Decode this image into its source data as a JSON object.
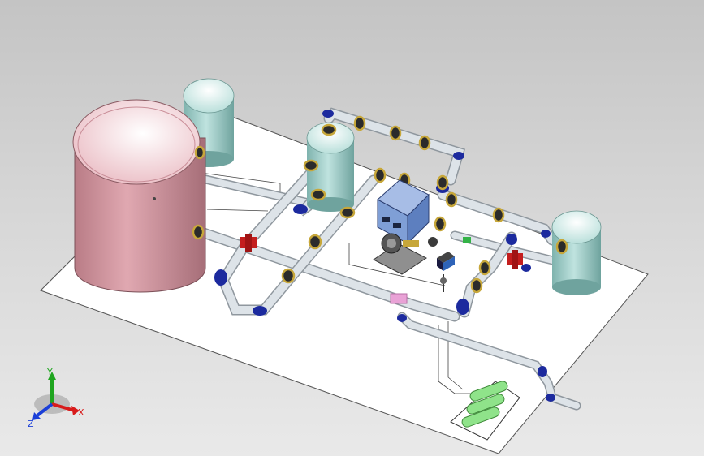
{
  "scene": {
    "colors": {
      "background_top": "#c4c4c4",
      "background_bottom": "#e9e9e9",
      "platform": "#ffffff",
      "platform_edge": "#555555",
      "large_tank": "#d99aa4",
      "large_tank_top": "#f6dde1",
      "small_tank": "#a9d4cf",
      "small_tank_top": "#e3f3f1",
      "pipe": "#d9dfe4",
      "pipe_shadow": "#8f979e",
      "elbow": "#1c2a9e",
      "flange": "#c7a73a",
      "valve_red": "#c41e1e",
      "valve_pink": "#e9a2d6",
      "valve_green": "#34b347",
      "cabinet": "#7f9fd6",
      "cylinder": "#8fe38a"
    },
    "objects": [
      "large-storage-tank",
      "small-tank-top-left",
      "small-tank-center",
      "small-tank-right",
      "pipe-network",
      "pump-unit",
      "control-cabinet",
      "gas-cylinder-rack"
    ]
  },
  "triad": {
    "labels": {
      "x": "X",
      "y": "Y",
      "z": "Z"
    },
    "colors": {
      "x": "#d81b1b",
      "y": "#1fa51f",
      "z": "#1b3fd8"
    }
  }
}
